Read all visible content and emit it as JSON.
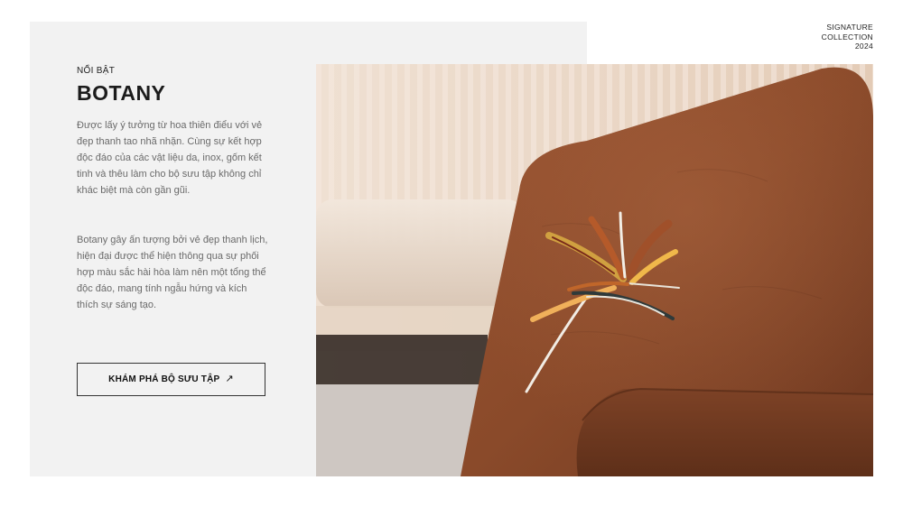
{
  "feature": {
    "eyebrow": "NỔI BẬT",
    "title": "BOTANY",
    "paragraphs": [
      "Được lấy ý tưởng từ hoa thiên điểu với vẻ đẹp thanh tao nhã nhặn. Cùng sự kết hợp độc đáo của các vật liệu da, inox, gốm kết tinh và thêu làm cho bộ sưu tập không chỉ khác biệt mà còn gần gũi.",
      "Botany gây ấn tượng bởi vẻ đẹp thanh lịch, hiện đại được thể hiện thông qua sự phối hợp màu sắc hài hòa làm nên một tổng thể độc đáo, mang tính ngẫu hứng và kích thích sự sáng tạo."
    ],
    "cta_label": "KHÁM PHÁ BỘ SƯU TẬP",
    "cta_icon": "arrow-up-right-icon"
  },
  "signature": {
    "lines": [
      "SIGNATURE",
      "COLLECTION",
      "2024"
    ]
  },
  "photo": {
    "subject": "brown-leather-armchair-with-bird-of-paradise-embroidery",
    "colors": {
      "leather": "#8a4a2a",
      "wall": "#e8d6c6",
      "panel_bg": "#f2f2f2"
    }
  }
}
